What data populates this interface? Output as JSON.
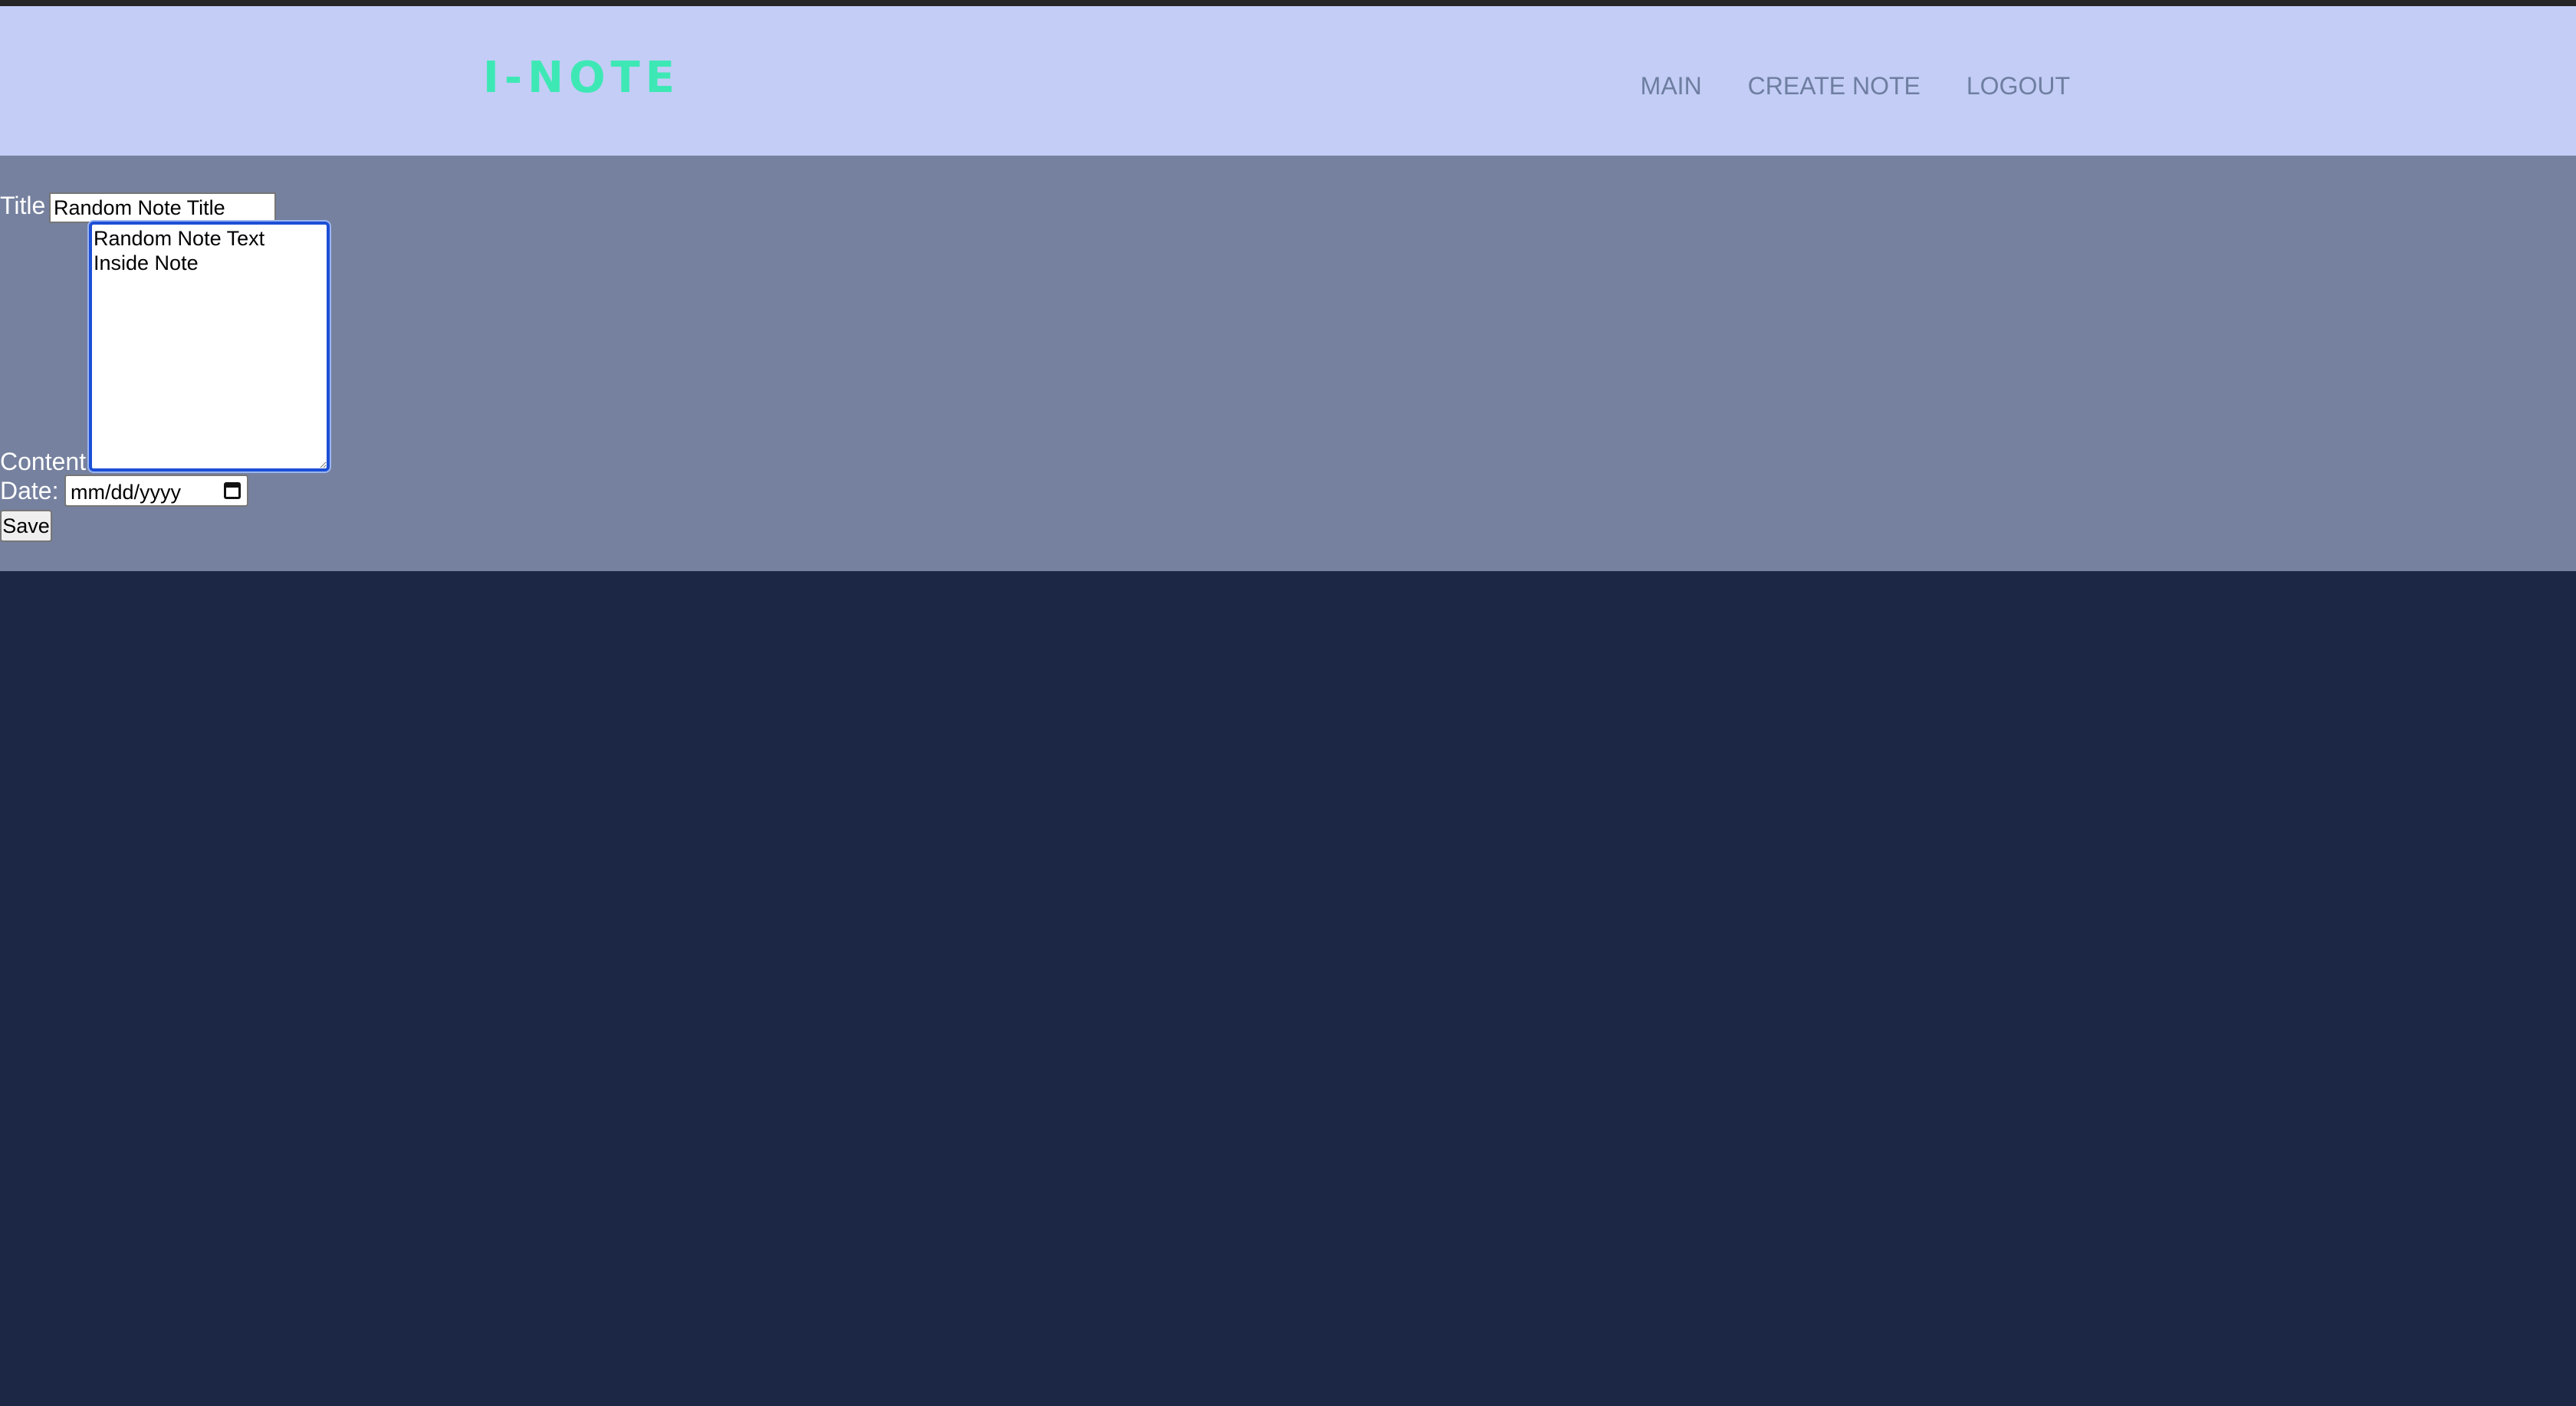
{
  "header": {
    "brand": "I-NOTE",
    "nav": [
      {
        "label": "MAIN"
      },
      {
        "label": "CREATE NOTE"
      },
      {
        "label": "LOGOUT"
      }
    ]
  },
  "form": {
    "title_label": "Title",
    "title_value": "Random Note Title",
    "content_label": "Content",
    "content_value": "Random Note Text Inside Note",
    "date_label": "Date:",
    "date_placeholder": "mm/dd/yyyy",
    "date_icon": "calendar-icon",
    "save_label": "Save"
  },
  "colors": {
    "header_bg": "#c3cdf6",
    "brand": "#3ee8b5",
    "nav_link": "#6e7ea0",
    "form_bg": "#76819f",
    "page_bg": "#1b2744"
  }
}
